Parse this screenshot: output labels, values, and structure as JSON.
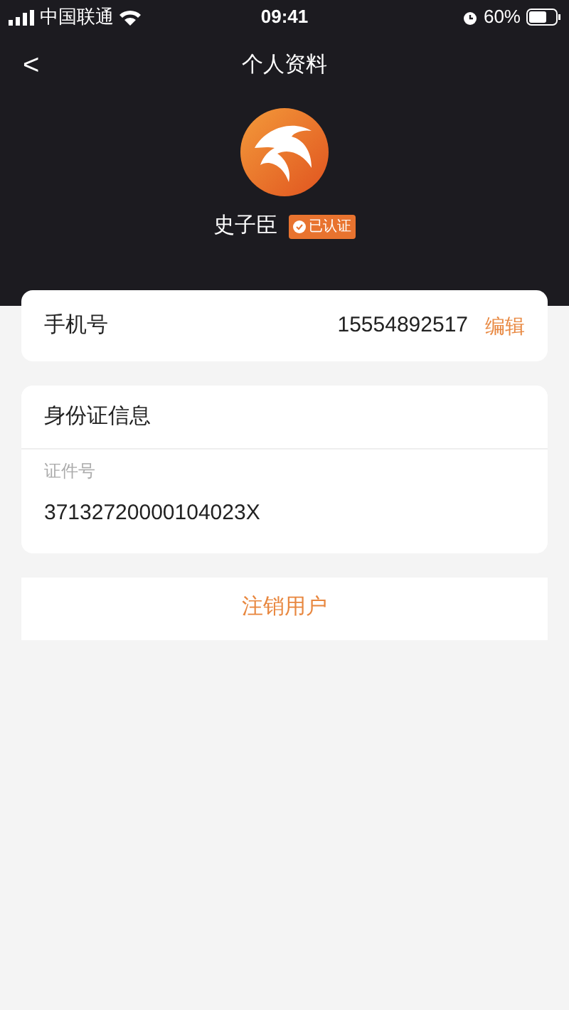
{
  "status_bar": {
    "carrier": "中国联通",
    "time": "09:41",
    "battery": "60%"
  },
  "header": {
    "back": "<",
    "title": "个人资料"
  },
  "profile": {
    "name": "史子臣",
    "verified": true,
    "badge": "已认证"
  },
  "phone": {
    "label": "手机号",
    "value": "15554892517",
    "action": "编辑"
  },
  "id_card": {
    "title": "身份证信息",
    "field_label": "证件号",
    "value": "37132720000104023X"
  },
  "logout_button": "注销用户"
}
